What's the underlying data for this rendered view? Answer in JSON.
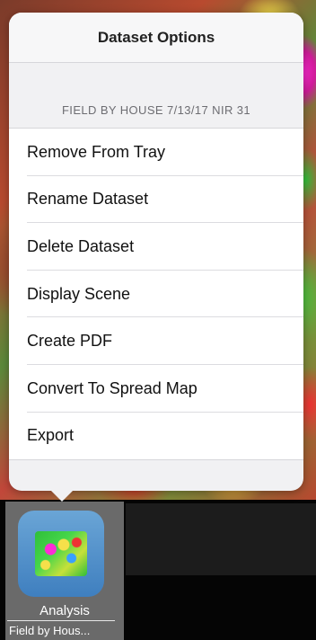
{
  "popover": {
    "title": "Dataset Options",
    "section_header": "FIELD BY HOUSE 7/13/17 NIR 31",
    "items": [
      {
        "label": "Remove From Tray"
      },
      {
        "label": "Rename Dataset"
      },
      {
        "label": "Delete Dataset"
      },
      {
        "label": "Display Scene"
      },
      {
        "label": "Create PDF"
      },
      {
        "label": "Convert To Spread Map"
      },
      {
        "label": "Export"
      }
    ]
  },
  "tray": {
    "item_label": "Analysis",
    "item_sublabel": "Field by Hous..."
  },
  "colors": {
    "popover_bg": "#f1f1f3",
    "menu_bg": "#ffffff",
    "separator": "#dcdce0",
    "tray_icon": "#4f8ccc"
  },
  "icons": {
    "tray_thumbnail": "field-map-thumbnail-icon"
  }
}
